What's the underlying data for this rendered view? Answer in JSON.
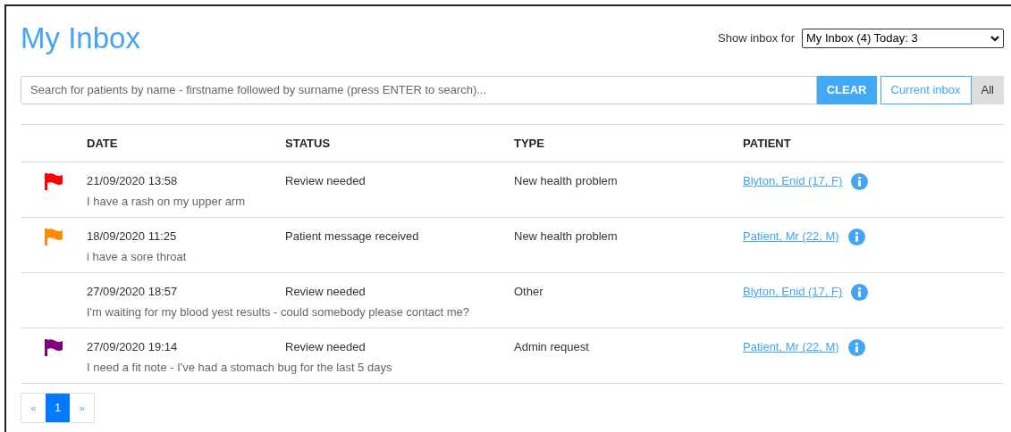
{
  "title": "My Inbox",
  "inbox_selector": {
    "label": "Show inbox for",
    "value": "My Inbox (4) Today: 3"
  },
  "search": {
    "placeholder": "Search for patients by name - firstname followed by surname (press ENTER to search)...",
    "clear": "CLEAR"
  },
  "filters": [
    {
      "label": "Current inbox",
      "selected": false
    },
    {
      "label": "All",
      "selected": true
    }
  ],
  "table": {
    "columns": [
      "DATE",
      "STATUS",
      "TYPE",
      "PATIENT"
    ],
    "rows": [
      {
        "color": "#ff0000",
        "date": "21/09/2020 13:58",
        "status": "Review needed",
        "type": "New health problem",
        "patient": "Blyton, Enid (17, F)",
        "message": "I have a rash on my upper arm"
      },
      {
        "color": "#ff8c00",
        "date": "18/09/2020 11:25",
        "status": "Patient message received",
        "type": "New health problem",
        "patient": "Patient, Mr (22, M)",
        "message": "i have a sore throat"
      },
      {
        "date": "27/09/2020 18:57",
        "status": "Review needed",
        "type": "Other",
        "patient": "Blyton, Enid (17, F)",
        "message": "I'm waiting for my blood yest results - could somebody please contact me?"
      },
      {
        "color": "#800080",
        "date": "27/09/2020 19:14",
        "status": "Review needed",
        "type": "Admin request",
        "patient": "Patient, Mr (22, M)",
        "message": "I need a fit note - I've had a stomach bug for the last 5 days"
      }
    ]
  },
  "pagination": [
    {
      "label": "«",
      "selected": false
    },
    {
      "label": "1",
      "selected": true
    },
    {
      "label": "»",
      "selected": false
    }
  ]
}
